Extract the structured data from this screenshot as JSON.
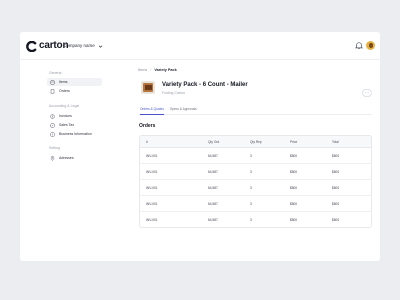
{
  "brand": {
    "name": "carton",
    "accent": "#4a54c9"
  },
  "header": {
    "company": "Company name",
    "icons": {
      "company_chevron": "chevron-down-icon",
      "notifications": "bell-icon",
      "avatar": "avatar"
    }
  },
  "sidebar": {
    "sections": [
      {
        "title": "General",
        "items": [
          {
            "label": "Items",
            "icon": "box-icon",
            "active": true
          },
          {
            "label": "Orders",
            "icon": "receipt-icon",
            "active": false
          }
        ]
      },
      {
        "title": "Accounting & Legal",
        "items": [
          {
            "label": "Invoices",
            "icon": "invoice-icon",
            "active": false
          },
          {
            "label": "Sales Tax",
            "icon": "tax-icon",
            "active": false
          },
          {
            "label": "Business Information",
            "icon": "info-icon",
            "active": false
          }
        ]
      },
      {
        "title": "Setting",
        "items": [
          {
            "label": "Adresses",
            "icon": "location-icon",
            "active": false
          }
        ]
      }
    ]
  },
  "breadcrumb": {
    "home": "Items",
    "separator": "/",
    "current": "Variety Pack"
  },
  "product": {
    "title": "Variety Pack - 6 Count - Mailer",
    "subtitle": "Folding Carton",
    "more_label": "···"
  },
  "tabs": [
    {
      "label": "Orders & Quotes",
      "active": true
    },
    {
      "label": "Specs & Approvals",
      "active": false
    }
  ],
  "orders": {
    "title": "Orders",
    "columns": [
      "#",
      "Qty Ord.",
      "Qty Rep",
      "Price",
      "Total"
    ],
    "rows": [
      [
        "INV-001",
        "64,587",
        "3",
        "$500",
        "$500"
      ],
      [
        "INV-001",
        "64,587",
        "3",
        "$500",
        "$500"
      ],
      [
        "INV-001",
        "64,587",
        "3",
        "$500",
        "$500"
      ],
      [
        "INV-001",
        "64,587",
        "3",
        "$500",
        "$500"
      ],
      [
        "INV-001",
        "64,587",
        "3",
        "$500",
        "$500"
      ]
    ]
  }
}
